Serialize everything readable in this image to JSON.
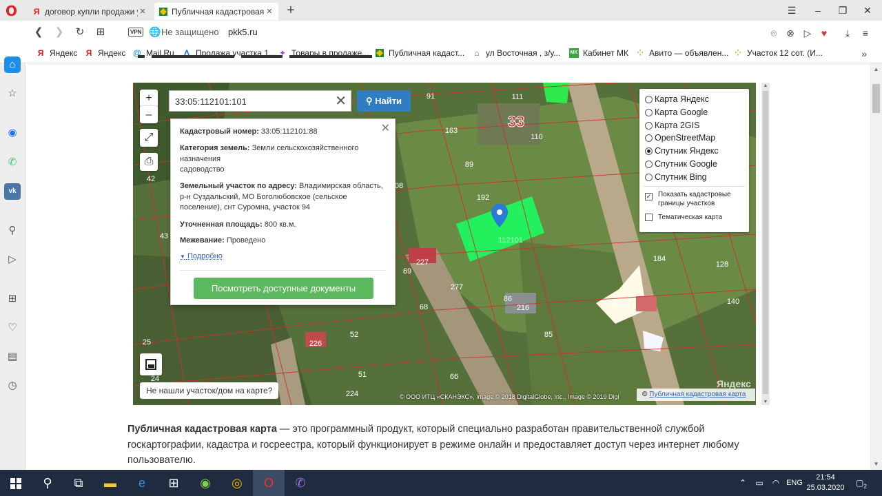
{
  "browser": {
    "tabs": [
      {
        "title": "договор купли продажи у",
        "favicon": "yandex-icon"
      },
      {
        "title": "Публичная кадастровая к",
        "favicon": "pkk-icon",
        "active": true
      }
    ],
    "address": {
      "vpn": "VPN",
      "security": "Не защищено",
      "url": "pkk5.ru"
    },
    "bookmarks": [
      {
        "label": "Яндекс",
        "icon": "yandex-icon"
      },
      {
        "label": "Яндекс",
        "icon": "yandex-icon"
      },
      {
        "label": "Mail.Ru",
        "icon": "mailru-icon"
      },
      {
        "label": "Продажа участка 1...",
        "icon": "avito-icon"
      },
      {
        "label": "Товары в продаже...",
        "icon": "star-icon"
      },
      {
        "label": "Публичная кадаст...",
        "icon": "pkk-icon"
      },
      {
        "label": "ул Восточная , з/у...",
        "icon": "house-icon"
      },
      {
        "label": "Кабинет МК",
        "icon": "mk-icon"
      },
      {
        "label": "Авито — объявлен...",
        "icon": "avito-icon"
      },
      {
        "label": "Участок 12 сот. (И...",
        "icon": "avito-icon"
      }
    ]
  },
  "map": {
    "search_value": "33:05:112101:101",
    "find_label": "Найти",
    "zoom_in": "+",
    "zoom_out": "–",
    "popup": {
      "cadnum_label": "Кадастровый номер:",
      "cadnum_value": "33:05:112101:88",
      "category_label": "Категория земель:",
      "category_value": "Земли сельскохозяйственного назначения",
      "category_sub": "садоводство",
      "address_label": "Земельный участок по адресу:",
      "address_value": "Владимирская область, р-н Суздальский, МО Боголюбовское (сельское поселение), снт Суромна, участок 94",
      "area_label": "Уточненная площадь:",
      "area_value": "800 кв.м.",
      "survey_label": "Межевание:",
      "survey_value": "Проведено",
      "more_label": "Подробно",
      "docs_button": "Посмотреть доступные документы"
    },
    "layers": [
      {
        "label": "Карта Яндекс",
        "selected": false
      },
      {
        "label": "Карта Google",
        "selected": false
      },
      {
        "label": "Карта 2GIS",
        "selected": false
      },
      {
        "label": "OpenStreetMap",
        "selected": false
      },
      {
        "label": "Спутник Яндекс",
        "selected": true
      },
      {
        "label": "Спутник Google",
        "selected": false
      },
      {
        "label": "Спутник Bing",
        "selected": false
      }
    ],
    "options": [
      {
        "label": "Показать кадастровые границы участков",
        "checked": true
      },
      {
        "label": "Тематическая карта",
        "checked": false
      }
    ],
    "not_found": "Не нашли участок/дом на карте?",
    "copyright": "© ООО ИТЦ «СКАНЭКС», Image © 2018 DigitalGlobe, Inc., Image © 2019 Digi",
    "pkk_link_prefix": "©",
    "pkk_link": "Публичная кадастровая карта",
    "watermark": "Яндекс",
    "parcel_labels": [
      "91",
      "111",
      "33",
      "163",
      "110",
      "89",
      "192",
      "112101",
      "42",
      "08",
      "43",
      "227",
      "69",
      "184",
      "128",
      "277",
      "105",
      "140",
      "86",
      "216",
      "68",
      "25",
      "52",
      "85",
      "51",
      "226",
      "66",
      "24",
      "224"
    ]
  },
  "article": {
    "bold": "Публичная кадастровая карта",
    "text": " — это программный продукт, который специально разработан правительственной службой госкартографии, кадастра и госреестра, который функционирует в режиме онлайн и предоставляет доступ через интернет любому пользователю."
  },
  "taskbar": {
    "lang": "ENG",
    "time": "21:54",
    "date": "25.03.2020",
    "notifications": "2"
  }
}
